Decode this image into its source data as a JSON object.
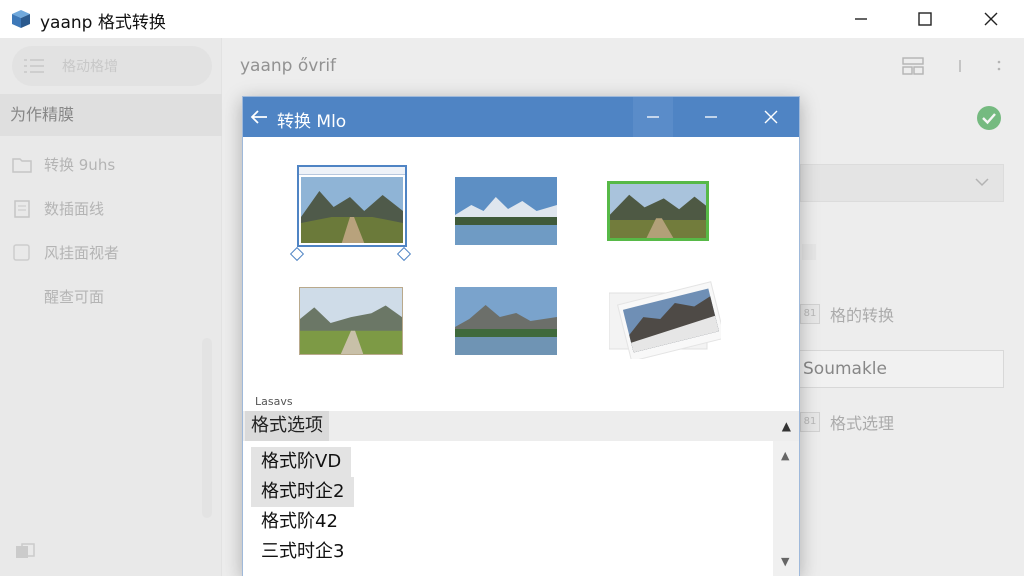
{
  "window": {
    "title": "yaanp 格式转换",
    "icon": "app-box-icon",
    "controls": [
      "minimize-icon",
      "maximize-icon",
      "close-icon"
    ]
  },
  "sidebar": {
    "search_label": "格动格增",
    "header": "为作精膜",
    "items": [
      {
        "label": "转换 9uhs",
        "icon": "folder-icon"
      },
      {
        "label": "数插面线",
        "icon": "document-icon"
      },
      {
        "label": "风挂面视者",
        "icon": "checkbox-icon"
      },
      {
        "label": "醒查可面",
        "icon": ""
      }
    ],
    "bottom_icon": "settings-icon"
  },
  "main": {
    "title": "yaanp ővrif",
    "status": "success",
    "status_color": "#3aa34a",
    "rows": [
      {
        "badge": "81",
        "label": "格的转换"
      },
      {
        "badge": "81",
        "label": "格式选理"
      }
    ],
    "input_value": "Soumakle"
  },
  "dialog": {
    "title": "转换 Mlo",
    "title_color": "#4f84c4",
    "section_label": "Lasavs",
    "options_header": "格式选项",
    "options": [
      {
        "label": "格式阶VD",
        "selected": true
      },
      {
        "label": "格式时企2",
        "selected": true
      },
      {
        "label": "格式阶42",
        "selected": false
      },
      {
        "label": "三式时企3",
        "selected": false
      }
    ],
    "thumbnails": [
      {
        "name": "mountain-road",
        "state": "selected"
      },
      {
        "name": "mountain-lake",
        "state": "normal"
      },
      {
        "name": "mountain-road-green",
        "state": "highlighted"
      },
      {
        "name": "valley-road",
        "state": "normal"
      },
      {
        "name": "mountain-lake-2",
        "state": "normal"
      },
      {
        "name": "tilted-photo",
        "state": "dragging"
      }
    ]
  }
}
